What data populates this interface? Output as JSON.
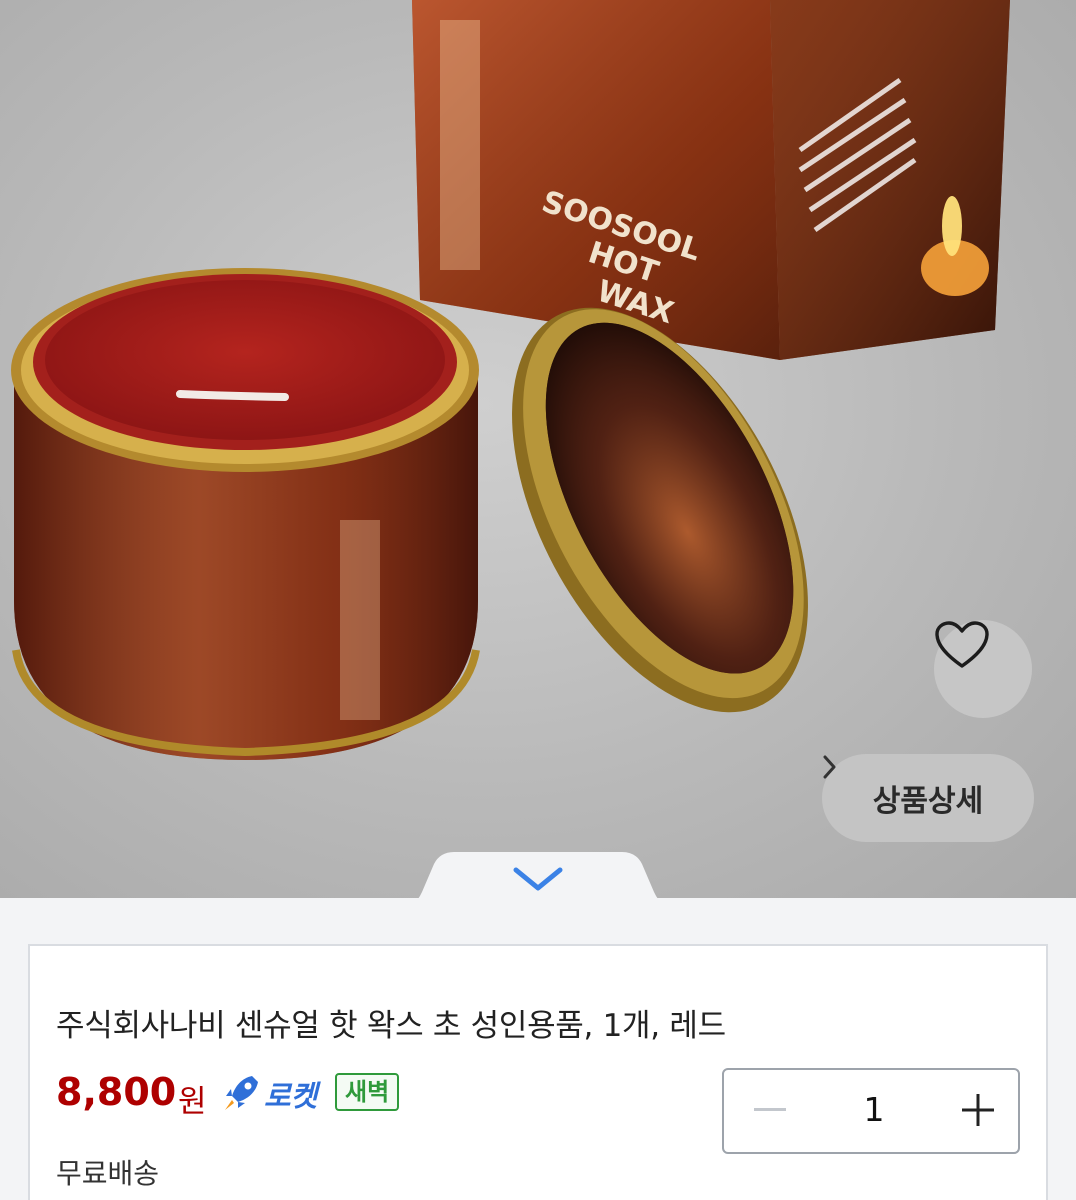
{
  "product_image": {
    "box_text": [
      "SOOSOOL",
      "HOT",
      "WAX"
    ]
  },
  "buttons": {
    "detail_label": "상품상세",
    "detail_chevron": "›"
  },
  "product": {
    "title": "주식회사나비 센슈얼 핫 왁스 초 성인용품, 1개, 레드",
    "price": "8,800",
    "currency": "원",
    "delivery_badge": "로켓",
    "delivery_sub_badge": "새벽",
    "shipping": "무료배송"
  },
  "quantity": {
    "value": "1"
  },
  "icons": {
    "wishlist": "heart-icon",
    "detail": "chevron-right-icon",
    "collapse": "chevron-down-icon",
    "rocket": "rocket-icon",
    "minus": "minus-icon",
    "plus": "plus-icon"
  },
  "colors": {
    "price": "#ae0000",
    "rocket": "#2f6fd8",
    "dawn_badge": "#2f9a3b",
    "collapse_chevron": "#3b82e6"
  }
}
